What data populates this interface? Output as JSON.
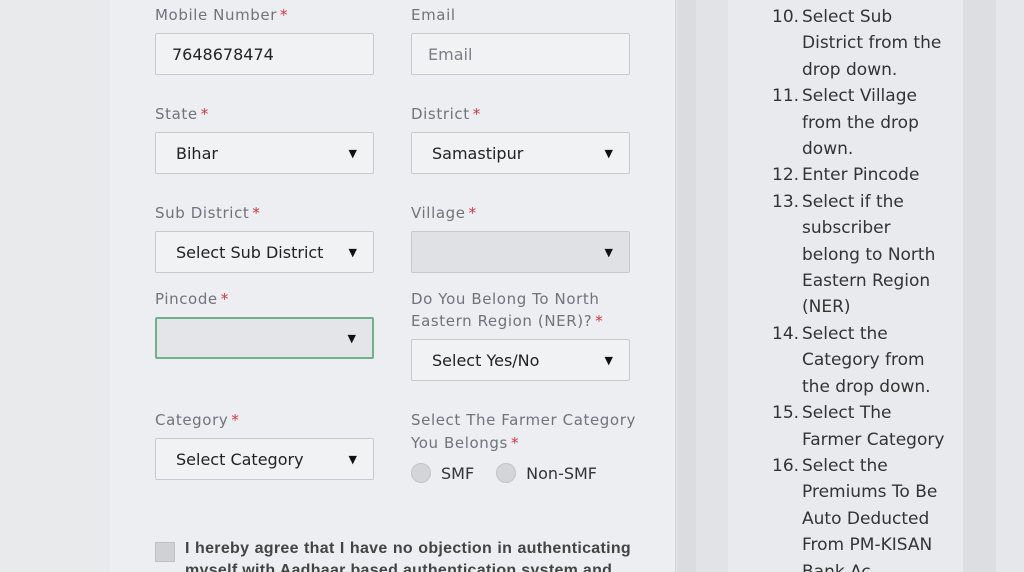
{
  "form": {
    "mobile": {
      "label": "Mobile Number",
      "value": "7648678474"
    },
    "email": {
      "label": "Email",
      "placeholder": "Email"
    },
    "state": {
      "label": "State",
      "value": "Bihar"
    },
    "district": {
      "label": "District",
      "value": "Samastipur"
    },
    "sub_district": {
      "label": "Sub District",
      "value": "Select Sub District"
    },
    "village": {
      "label": "Village",
      "value": ""
    },
    "pincode": {
      "label": "Pincode",
      "value": ""
    },
    "ner": {
      "label_line1": "Do You Belong To North",
      "label_line2": "Eastern Region (NER)?",
      "value": "Select Yes/No"
    },
    "category": {
      "label": "Category",
      "value": "Select Category"
    },
    "farmer_category": {
      "label_line1": "Select The Farmer Category",
      "label_line2": "You Belongs",
      "options": [
        "SMF",
        "Non-SMF"
      ]
    },
    "required_marker": "*",
    "caret": "▼",
    "agreement": "I hereby agree that I have no objection in authenticating myself with Aadhaar based authentication system and"
  },
  "steps": [
    {
      "num": "10.",
      "text": "Select Sub District from the drop down."
    },
    {
      "num": "11.",
      "text": "Select Village from the drop down."
    },
    {
      "num": "12.",
      "text": "Enter Pincode"
    },
    {
      "num": "13.",
      "text": "Select if the subscriber belong to North Eastern Region (NER)"
    },
    {
      "num": "14.",
      "text": "Select the Category from the drop down."
    },
    {
      "num": "15.",
      "text": "Select The Farmer Category"
    },
    {
      "num": "16.",
      "text": "Select the Premiums To Be Auto Deducted From PM-KISAN Bank Ac"
    }
  ]
}
